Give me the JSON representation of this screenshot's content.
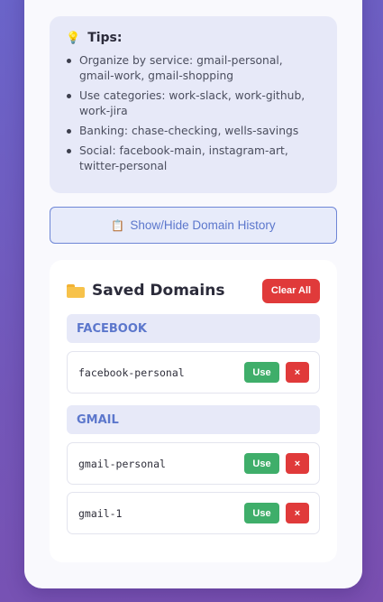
{
  "tips": {
    "icon": "lightbulb-icon",
    "title": "Tips:",
    "items": [
      "Organize by service: gmail-personal, gmail-work, gmail-shopping",
      "Use categories: work-slack, work-github, work-jira",
      "Banking: chase-checking, wells-savings",
      "Social: facebook-main, instagram-art, twitter-personal"
    ]
  },
  "history_button": {
    "icon": "clipboard-icon",
    "label": "Show/Hide Domain History"
  },
  "saved": {
    "icon": "folder-icon",
    "title": "Saved Domains",
    "clear_label": "Clear All",
    "groups": [
      {
        "name": "FACEBOOK",
        "domains": [
          {
            "name": "facebook-personal",
            "use_label": "Use",
            "delete_label": "×"
          }
        ]
      },
      {
        "name": "GMAIL",
        "domains": [
          {
            "name": "gmail-personal",
            "use_label": "Use",
            "delete_label": "×"
          },
          {
            "name": "gmail-1",
            "use_label": "Use",
            "delete_label": "×"
          }
        ]
      }
    ]
  },
  "colors": {
    "accent": "#5c77cc",
    "danger": "#e03a3a",
    "success": "#3fae6a",
    "panel": "#e7e9f8"
  }
}
